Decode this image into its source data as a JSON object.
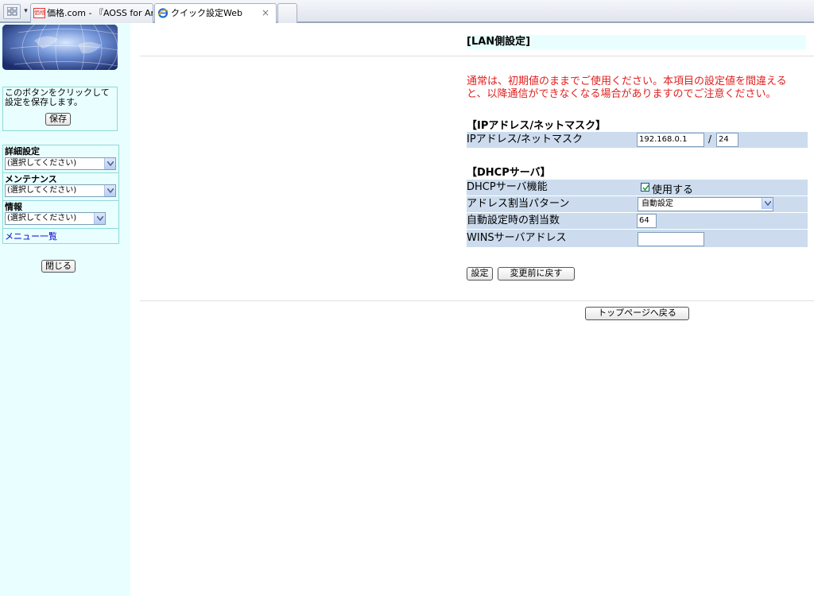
{
  "browser": {
    "tabs": [
      {
        "label": "価格.com - 『AOSS for Andr..."
      },
      {
        "label": "クイック設定Web",
        "close": "×"
      }
    ],
    "favicon_badge": "価格"
  },
  "sidebar": {
    "save_text": "このボタンをクリックして設定を保存します。",
    "save_button": "保存",
    "menus": [
      {
        "label": "詳細設定",
        "selected": "(選択してください)"
      },
      {
        "label": "メンテナンス",
        "selected": "(選択してください)"
      },
      {
        "label": "情報",
        "selected": "(選択してください)"
      }
    ],
    "menu_list_link": "メニュー一覧",
    "close_button": "閉じる"
  },
  "main": {
    "title": "[LAN側設定]",
    "warning": "通常は、初期値のままでご使用ください。本項目の設定値を間違えると、以降通信ができなくなる場合がありますのでご注意ください。",
    "ip_section": {
      "title": "【IPアドレス/ネットマスク】",
      "label": "IPアドレス/ネットマスク",
      "ip_value": "192.168.0.1",
      "separator": "/",
      "mask_value": "24"
    },
    "dhcp_section": {
      "title": "【DHCPサーバ】",
      "function_label": "DHCPサーバ機能",
      "function_checkbox": "使用する",
      "function_checked": true,
      "pattern_label": "アドレス割当パターン",
      "pattern_value": "自動設定",
      "count_label": "自動設定時の割当数",
      "count_value": "64",
      "wins_label": "WINSサーバアドレス",
      "wins_value": ""
    },
    "set_button": "設定",
    "revert_button": "変更前に戻す",
    "top_page_button": "トップページへ戻る"
  }
}
